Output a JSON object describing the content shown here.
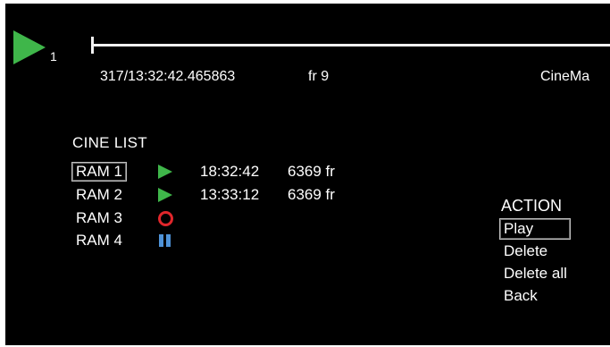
{
  "colors": {
    "screen_background": "#000000",
    "text": "#ffffff",
    "play_green": "#3fb64a",
    "record_red": "#e0262b",
    "pause_blue": "#4f93d8"
  },
  "header": {
    "play_icon": "play-icon",
    "clip_number": "1",
    "timecode": "317/13:32:42.465863",
    "frame_label": "fr 9",
    "magazine_label": "CineMa"
  },
  "cine_list": {
    "title": "CINE LIST",
    "items": [
      {
        "label": "RAM 1",
        "status_icon": "play-icon",
        "time": "18:32:42",
        "frames": "6369 fr",
        "selected": true
      },
      {
        "label": "RAM 2",
        "status_icon": "play-icon",
        "time": "13:33:12",
        "frames": "6369 fr",
        "selected": false
      },
      {
        "label": "RAM 3",
        "status_icon": "record-icon",
        "time": "",
        "frames": "",
        "selected": false
      },
      {
        "label": "RAM 4",
        "status_icon": "pause-icon",
        "time": "",
        "frames": "",
        "selected": false
      }
    ]
  },
  "action_menu": {
    "title": "ACTION",
    "items": [
      {
        "label": "Play",
        "selected": true
      },
      {
        "label": "Delete",
        "selected": false
      },
      {
        "label": "Delete all",
        "selected": false
      },
      {
        "label": "Back",
        "selected": false
      }
    ]
  }
}
